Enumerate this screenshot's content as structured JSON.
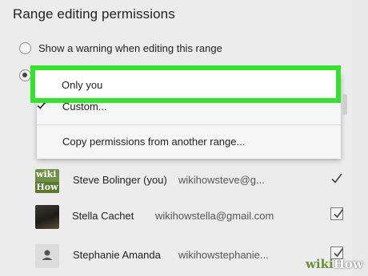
{
  "dialog": {
    "title": "Range editing permissions",
    "option_warning_label": "Show a warning when editing this range",
    "option_restrict_selected": true
  },
  "dropdown": {
    "highlighted_item": "Only you",
    "items": [
      {
        "label": "Custom...",
        "checked": true
      },
      {
        "label": "Copy permissions from another range..."
      }
    ]
  },
  "users": [
    {
      "name": "Steve Bolinger (you)",
      "email": "wikihowsteve@g...",
      "can_edit": true,
      "avatar": "wikihow-logo-avatar",
      "avatar_text_top": "wiki",
      "avatar_text_bottom": "How"
    },
    {
      "name": "Stella Cachet",
      "email": "wikihowstella@gmail.com",
      "can_edit": true,
      "avatar": "photo-avatar"
    },
    {
      "name": "Stephanie Amanda",
      "email": "wikihowstephanie...",
      "can_edit": true,
      "avatar": "person-icon"
    }
  ],
  "watermark": {
    "wiki": "wiki",
    "how": "How"
  },
  "colors": {
    "highlight_border": "#37e12f",
    "background": "#ececec"
  }
}
